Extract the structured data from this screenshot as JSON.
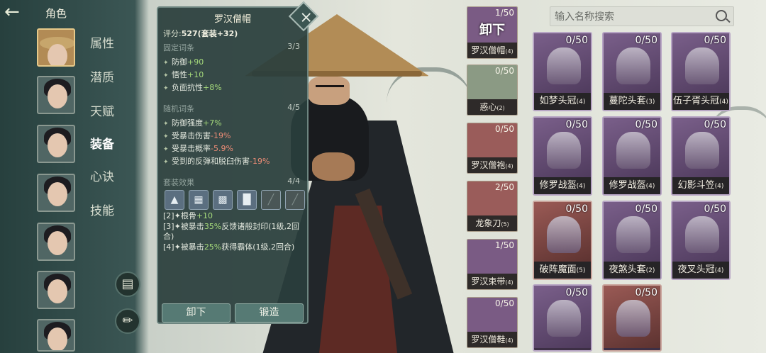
{
  "header": {
    "back_icon": "arrow-left-icon",
    "title": "角色"
  },
  "sidebar": {
    "menu": [
      "属性",
      "潜质",
      "天赋",
      "装备",
      "心诀",
      "技能"
    ],
    "active_menu": "装备",
    "tool_buttons": [
      "armor-icon",
      "broom-icon"
    ]
  },
  "tooltip": {
    "title": "罗汉僧帽",
    "score_label": "评分:",
    "score_value": "527(套装+32)",
    "fixed": {
      "label": "固定词条",
      "count": "3/3",
      "lines": [
        {
          "k": "防御",
          "v": "+90"
        },
        {
          "k": "悟性",
          "v": "+10"
        },
        {
          "k": "负面抗性",
          "v": "+8%"
        }
      ]
    },
    "random": {
      "label": "随机词条",
      "count": "4/5",
      "lines": [
        {
          "k": "防御强度",
          "v": "+7%",
          "t": "g"
        },
        {
          "k": "受暴击伤害",
          "v": "-19%",
          "t": "r"
        },
        {
          "k": "受暴击概率",
          "v": "-5.9%",
          "t": "r"
        },
        {
          "k": "受到的反弹和脱臼伤害",
          "v": "-19%",
          "t": "r"
        }
      ]
    },
    "set": {
      "label": "套装效果",
      "count": "4/4",
      "icons": [
        "hat-icon",
        "armor-icon",
        "belt-icon",
        "boot-icon",
        "weapon-icon",
        "weapon-icon"
      ],
      "effects": [
        {
          "pre": "[2]",
          "k": "根骨",
          "v": "+10",
          "post": ""
        },
        {
          "pre": "[3]",
          "k": "被暴击",
          "v": "35%",
          "post": "反馈诸般封印(1级,2回合)"
        },
        {
          "pre": "[4]",
          "k": "被暴击",
          "v": "25%",
          "post": "获得霸体(1级,2回合)"
        }
      ]
    },
    "buttons": {
      "unequip": "卸下",
      "forge": "锻造"
    }
  },
  "equipped": [
    {
      "count": "1/50",
      "name": "罗汉僧帽",
      "lvl": "(4)",
      "overlay": "卸下"
    },
    {
      "count": "0/50",
      "name": "惑心",
      "lvl": "(2)"
    },
    {
      "count": "0/50",
      "name": "罗汉僧袍",
      "lvl": "(4)"
    },
    {
      "count": "2/50",
      "name": "龙象刀",
      "lvl": "(5)"
    },
    {
      "count": "1/50",
      "name": "罗汉束带",
      "lvl": "(4)"
    },
    {
      "count": "0/50",
      "name": "罗汉僧鞋",
      "lvl": "(4)"
    }
  ],
  "search": {
    "placeholder": "输入名称搜索"
  },
  "inventory": [
    {
      "count": "0/50",
      "name": "如梦头冠",
      "lvl": "(4)",
      "style": "purple"
    },
    {
      "count": "0/50",
      "name": "蔓陀头套",
      "lvl": "(3)",
      "style": "purple"
    },
    {
      "count": "0/50",
      "name": "伍子胥头冠",
      "lvl": "(4)",
      "style": "purple"
    },
    {
      "count": "0/50",
      "name": "修罗战盔",
      "lvl": "(4)",
      "style": "purple"
    },
    {
      "count": "0/50",
      "name": "修罗战盔",
      "lvl": "(4)",
      "style": "purple"
    },
    {
      "count": "0/50",
      "name": "幻影斗笠",
      "lvl": "(4)",
      "style": "purple"
    },
    {
      "count": "0/50",
      "name": "破阵魔面",
      "lvl": "(5)",
      "style": "red"
    },
    {
      "count": "0/50",
      "name": "夜煞头套",
      "lvl": "(2)",
      "style": "purple"
    },
    {
      "count": "0/50",
      "name": "夜叉头冠",
      "lvl": "(4)",
      "style": "purple"
    },
    {
      "count": "0/50",
      "name": "",
      "lvl": "",
      "style": "purple"
    },
    {
      "count": "0/50",
      "name": "",
      "lvl": "",
      "style": "red"
    }
  ],
  "colors": {
    "bonus": "#a7dc7c",
    "penalty": "#ec8c76",
    "panel": "#2a3e3c"
  }
}
